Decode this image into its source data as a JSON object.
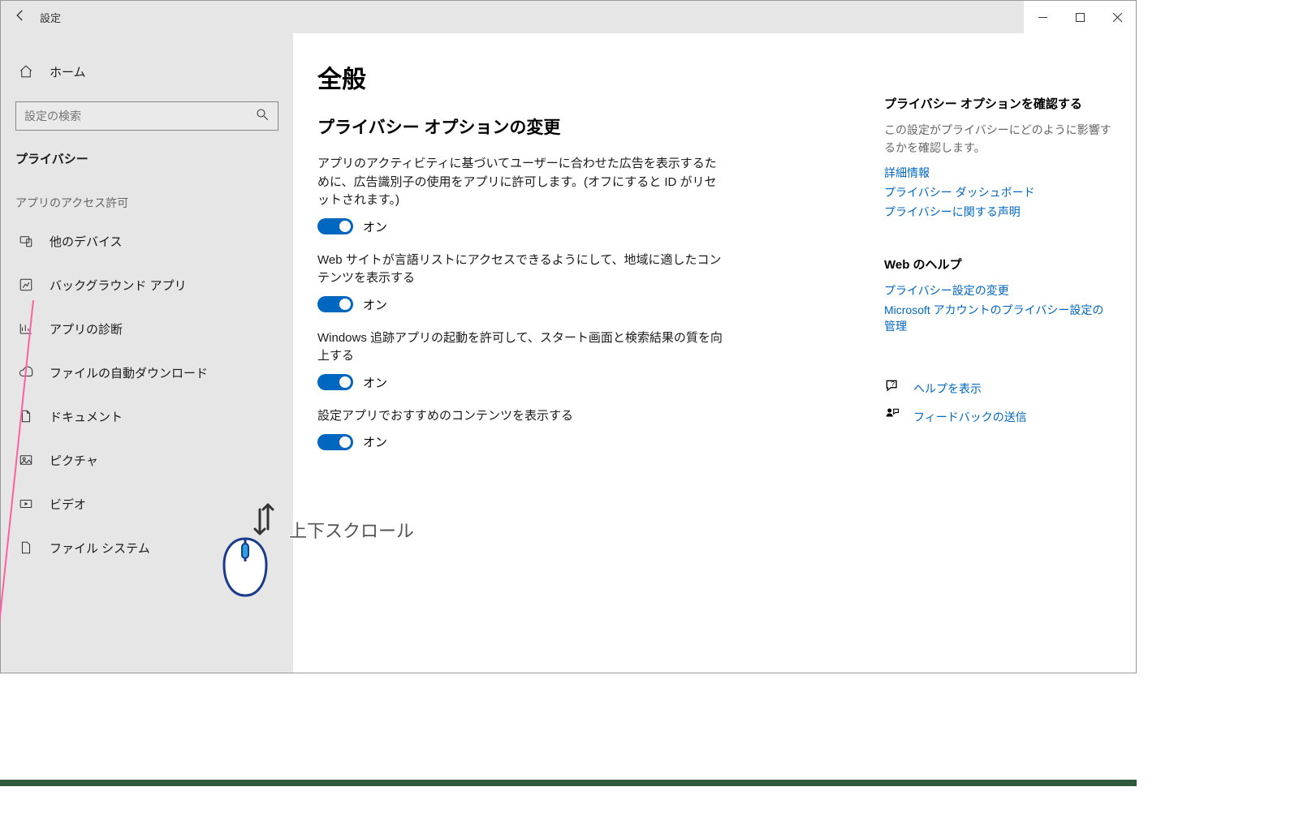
{
  "window": {
    "back_aria": "戻る",
    "title": "設定"
  },
  "sidebar": {
    "home": "ホーム",
    "search_placeholder": "設定の検索",
    "category": "プライバシー",
    "subheader": "アプリのアクセス許可",
    "items": [
      {
        "label": "他のデバイス"
      },
      {
        "label": "バックグラウンド アプリ"
      },
      {
        "label": "アプリの診断"
      },
      {
        "label": "ファイルの自動ダウンロード"
      },
      {
        "label": "ドキュメント"
      },
      {
        "label": "ピクチャ"
      },
      {
        "label": "ビデオ"
      },
      {
        "label": "ファイル システム"
      }
    ]
  },
  "page": {
    "title": "全般",
    "section": "プライバシー オプションの変更",
    "options": [
      {
        "label": "アプリのアクティビティに基づいてユーザーに合わせた広告を表示するために、広告識別子の使用をアプリに許可します。(オフにすると ID がリセットされます。)",
        "state": "オン"
      },
      {
        "label": "Web サイトが言語リストにアクセスできるようにして、地域に適したコンテンツを表示する",
        "state": "オン"
      },
      {
        "label": "Windows 追跡アプリの起動を許可して、スタート画面と検索結果の質を向上する",
        "state": "オン"
      },
      {
        "label": "設定アプリでおすすめのコンテンツを表示する",
        "state": "オン"
      }
    ]
  },
  "right": {
    "h1": "プライバシー オプションを確認する",
    "desc": "この設定がプライバシーにどのように影響するかを確認します。",
    "links1": [
      "詳細情報",
      "プライバシー ダッシュボード",
      "プライバシーに関する声明"
    ],
    "h2": "Web のヘルプ",
    "links2": [
      "プライバシー設定の変更",
      "Microsoft アカウントのプライバシー設定の管理"
    ],
    "help": "ヘルプを表示",
    "feedback": "フィードバックの送信"
  },
  "annotation": {
    "scroll_text": "上下スクロール"
  }
}
